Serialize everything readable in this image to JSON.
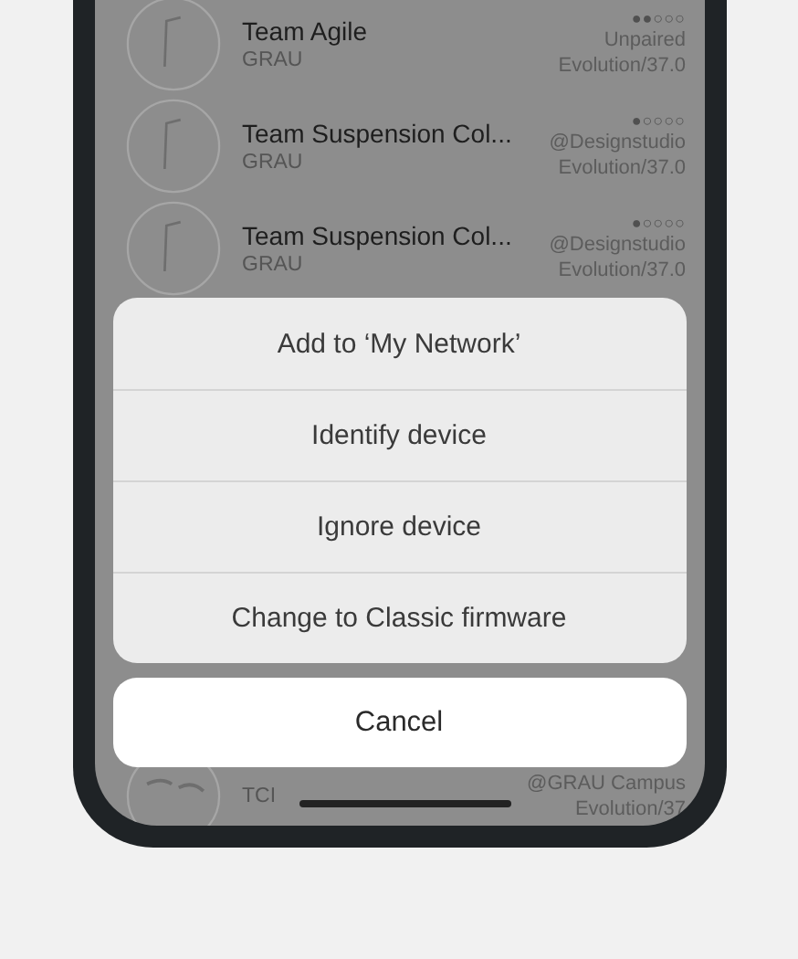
{
  "devices": [
    {
      "name": "Team Agile",
      "subtitle": "GRAU",
      "signal": "●●○○○",
      "owner": "Unpaired",
      "version": "Evolution/37.0"
    },
    {
      "name": "Team Suspension Col...",
      "subtitle": "GRAU",
      "signal": "●○○○○",
      "owner": "@Designstudio",
      "version": "Evolution/37.0"
    },
    {
      "name": "Team Suspension Col...",
      "subtitle": "GRAU",
      "signal": "●○○○○",
      "owner": "@Designstudio",
      "version": "Evolution/37.0"
    }
  ],
  "partial_device": {
    "subtitle": "TCI",
    "owner": "@GRAU Campus",
    "version": "Evolution/37"
  },
  "action_sheet": {
    "actions": [
      "Add to ‘My Network’",
      "Identify device",
      "Ignore device",
      "Change to Classic firmware"
    ],
    "cancel": "Cancel"
  }
}
